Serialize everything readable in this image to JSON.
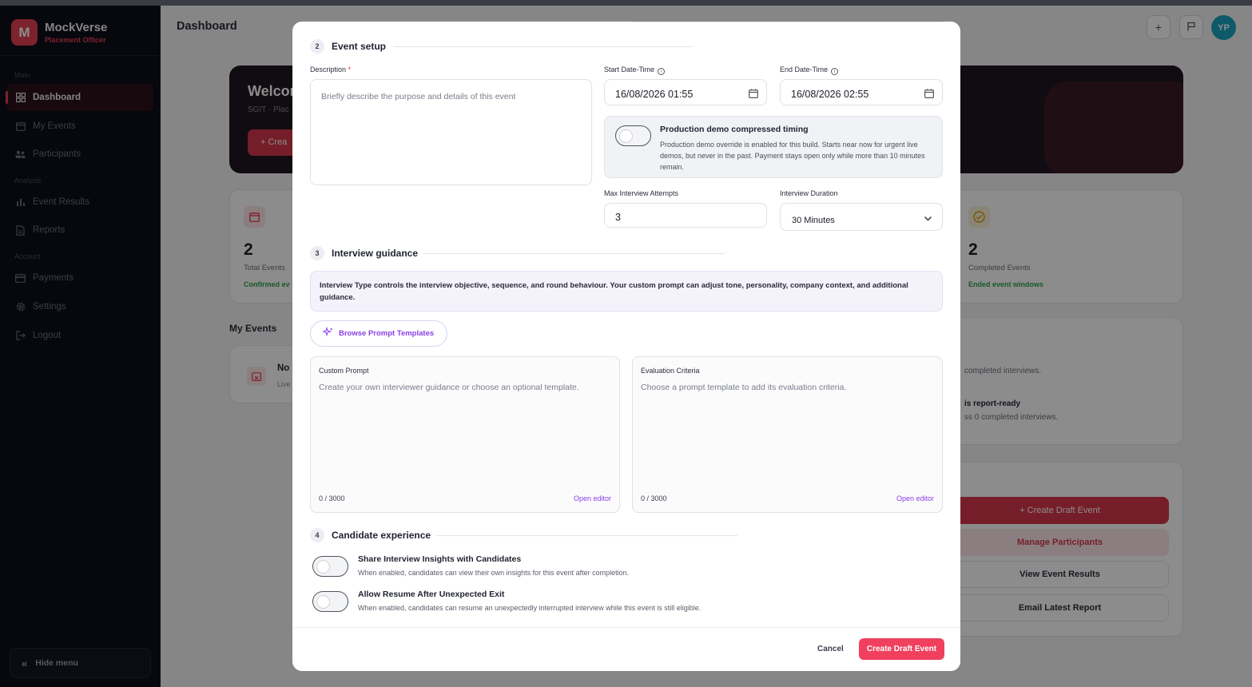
{
  "app": {
    "name": "MockVerse",
    "role": "Placement Officer",
    "logo_letter": "M"
  },
  "sidebar": {
    "sections": {
      "main": "Main",
      "analysis": "Analysis",
      "account": "Account"
    },
    "items": [
      {
        "label": "Dashboard",
        "icon": "grid-icon",
        "active": true
      },
      {
        "label": "My Events",
        "icon": "calendar-icon"
      },
      {
        "label": "Participants",
        "icon": "users-icon"
      },
      {
        "label": "Event Results",
        "icon": "bar-chart-icon"
      },
      {
        "label": "Reports",
        "icon": "document-icon"
      },
      {
        "label": "Payments",
        "icon": "credit-card-icon"
      },
      {
        "label": "Settings",
        "icon": "gear-icon"
      },
      {
        "label": "Logout",
        "icon": "logout-icon"
      }
    ],
    "hide_menu": "Hide menu"
  },
  "header": {
    "title": "Dashboard",
    "avatar_initials": "YP"
  },
  "background": {
    "hero": {
      "welcome": "Welcon",
      "sub": "SGIT · Plac",
      "button": "+ Crea"
    },
    "stats": [
      {
        "value": "2",
        "label": "Total Events",
        "foot": "Confirmed ev"
      },
      {
        "value": "2",
        "label": "Completed Events",
        "foot": "Ended event windows"
      }
    ],
    "my_events_title": "My Events",
    "empty_event": {
      "title": "No",
      "sub": "Live"
    },
    "insights": {
      "line1": "completed interviews.",
      "bold": "is report-ready",
      "line2": "ss 0 completed interviews."
    },
    "quick_actions": {
      "create": "+ Create Draft Event",
      "manage": "Manage Participants",
      "results": "View Event Results",
      "email": "Email Latest Report"
    }
  },
  "modal": {
    "event_setup": {
      "number": "2",
      "title": "Event setup",
      "description_label": "Description",
      "required_mark": "*",
      "description_placeholder": "Briefly describe the purpose and details of this event",
      "start_label": "Start Date-Time",
      "start_value": "16/08/2026 01:55",
      "end_label": "End Date-Time",
      "end_value": "16/08/2026 02:55",
      "demo_title": "Production demo compressed timing",
      "demo_text": "Production demo override is enabled for this build. Starts near now for urgent live demos, but never in the past. Payment stays open only while more than 10 minutes remain.",
      "attempts_label": "Max Interview Attempts",
      "attempts_value": "3",
      "duration_label": "Interview Duration",
      "duration_value": "30 Minutes"
    },
    "guidance": {
      "number": "3",
      "title": "Interview guidance",
      "note": "Interview Type controls the interview objective, sequence, and round behaviour. Your custom prompt can adjust tone, personality, company context, and additional guidance.",
      "browse_button": "Browse Prompt Templates",
      "custom_label": "Custom Prompt",
      "custom_placeholder": "Create your own interviewer guidance or choose an optional template.",
      "custom_count": "0 / 3000",
      "eval_label": "Evaluation Criteria",
      "eval_placeholder": "Choose a prompt template to add its evaluation criteria.",
      "eval_count": "0 / 3000",
      "open_editor": "Open editor"
    },
    "candidate": {
      "number": "4",
      "title": "Candidate experience",
      "share_title": "Share Interview Insights with Candidates",
      "share_desc": "When enabled, candidates can view their own insights for this event after completion.",
      "resume_title": "Allow Resume After Unexpected Exit",
      "resume_desc": "When enabled, candidates can resume an unexpectedly interrupted interview while this event is still eligible."
    },
    "footer": {
      "cancel": "Cancel",
      "create": "Create Draft Event"
    }
  },
  "colors": {
    "accent": "#e2344c",
    "purple": "#8b3fe6",
    "sidebar_bg": "#0e1018"
  }
}
